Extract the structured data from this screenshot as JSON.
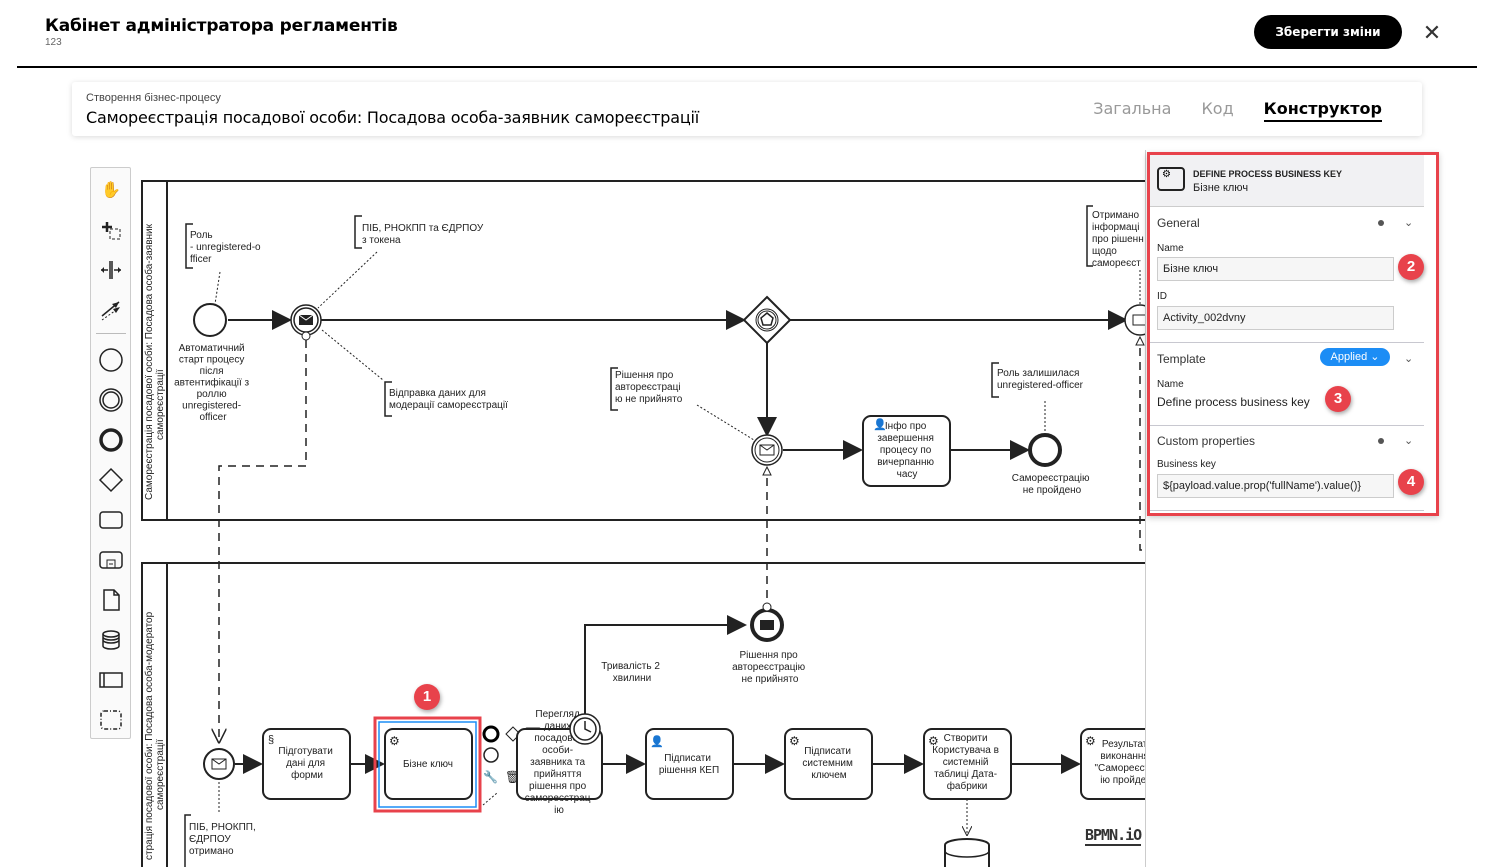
{
  "app": {
    "title": "Кабінет адміністратора регламентів",
    "subtitle": "123",
    "save_label": "Зберегти зміни",
    "close_icon": "close-icon"
  },
  "process": {
    "kicker": "Створення бізнес-процесу",
    "title": "Самореєстрація посадової особи: Посадова особа-заявник самореєстрації",
    "tabs": [
      {
        "label": "Загальна",
        "active": false
      },
      {
        "label": "Код",
        "active": false
      },
      {
        "label": "Конструктор",
        "active": true
      }
    ]
  },
  "palette": {
    "tools": [
      "hand-tool-icon",
      "lasso-tool-icon",
      "space-tool-icon",
      "global-connect-icon",
      "start-event-icon",
      "intermediate-event-icon",
      "end-event-icon",
      "gateway-icon",
      "task-icon",
      "subprocess-icon",
      "data-object-icon",
      "data-store-icon",
      "participant-icon",
      "group-icon"
    ]
  },
  "diagram": {
    "lane1_label": "Самореєстрація посадової особи: Посадова особа-заявник самореєстрації",
    "lane2_label": "Самореєстрація посадової особи: Посадова особа-модератор самореєстрації",
    "annotations": {
      "role": [
        "Роль",
        "- unregistered-o",
        "fficer"
      ],
      "token": [
        "ПІБ, РНОКПП та ЄДРПОУ",
        "з токена"
      ],
      "send": [
        "Відправка даних для",
        "модерації самореєстрації"
      ],
      "not_accepted": [
        "Рішення про",
        "автореєстраці",
        "ю не прийнято"
      ],
      "role_left": [
        "Роль залишилася",
        "unregistered-officer"
      ],
      "received": [
        "Отримано",
        "інформаці",
        "про рішенн",
        "щодо",
        "самореєст"
      ],
      "pib_received": [
        "ПІБ, РНОКПП,",
        "ЄДРПОУ",
        "отримано"
      ]
    },
    "labels": {
      "start": [
        "Автоматичний",
        "старт процесу",
        "після",
        "автентифікації з",
        "роллю",
        "unregistered-",
        "officer"
      ],
      "info_task": [
        "Інфо про",
        "завершення",
        "процесу по",
        "вичерпанню",
        "часу"
      ],
      "end_fail": [
        "Самореєстрацію",
        "не пройдено"
      ],
      "prepare_task": [
        "Підготувати",
        "дані для",
        "форми"
      ],
      "business_key_task": [
        "Бізне ключ"
      ],
      "review_task": [
        "Перегляд",
        "даних",
        "посадової",
        "особи-",
        "заявника та",
        "прийняття",
        "рішення про",
        "самореєстрац",
        "ію"
      ],
      "timer_label": [
        "Тривалість 2",
        "хвилини"
      ],
      "end_msg": [
        "Рішення про",
        "автореєстрацію",
        "не прийнято"
      ],
      "sign_kep": [
        "Підписати",
        "рішення КЕП"
      ],
      "sign_sys": [
        "Підписати",
        "системним",
        "ключем"
      ],
      "create_user": [
        "Створити",
        "Користувача в",
        "системній",
        "таблиці Дата-",
        "фабрики"
      ],
      "result": [
        "Результат",
        "виконання",
        "\"Самореєстр",
        "ію пройден"
      ]
    },
    "watermark": "BPMN.iO"
  },
  "properties": {
    "type": "DEFINE PROCESS BUSINESS KEY",
    "name": "Бізне ключ",
    "general": {
      "title": "General",
      "name_label": "Name",
      "name_value": "Бізне ключ",
      "id_label": "ID",
      "id_value": "Activity_002dvny"
    },
    "template": {
      "title": "Template",
      "badge": "Applied ⌄",
      "name_label": "Name",
      "name_value": "Define process business key"
    },
    "custom": {
      "title": "Custom properties",
      "key_label": "Business key",
      "key_value": "${payload.value.prop('fullName').value()}"
    }
  },
  "callouts": [
    "1",
    "2",
    "3",
    "4"
  ],
  "colors": {
    "accent": "#e8424b",
    "applied": "#1c8df5",
    "selection": "#1c8df5"
  }
}
